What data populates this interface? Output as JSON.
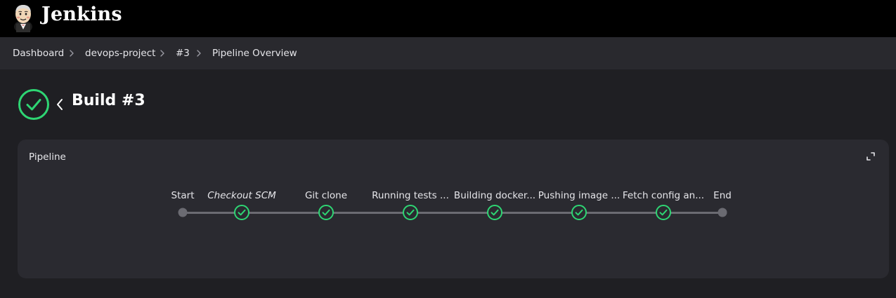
{
  "header": {
    "brand": "Jenkins",
    "logo_icon": "jenkins-butler-logo",
    "background": "#000000"
  },
  "breadcrumb": {
    "items": [
      {
        "label": "Dashboard"
      },
      {
        "label": "devops-project"
      },
      {
        "label": "#3"
      },
      {
        "label": "Pipeline Overview"
      }
    ]
  },
  "build": {
    "title": "Build #3",
    "status": "success",
    "status_icon": "check-circle-icon",
    "status_color": "#2ed573",
    "back_icon": "chevron-left-icon"
  },
  "pipeline": {
    "title": "Pipeline",
    "expand_icon": "expand-icon",
    "stages": [
      {
        "label": "Start",
        "kind": "terminal",
        "italic": false
      },
      {
        "label": "Checkout SCM",
        "kind": "success",
        "italic": true
      },
      {
        "label": "Git clone",
        "kind": "success",
        "italic": false
      },
      {
        "label": "Running tests ...",
        "kind": "success",
        "italic": false
      },
      {
        "label": "Building docker...",
        "kind": "success",
        "italic": false
      },
      {
        "label": "Pushing image ...",
        "kind": "success",
        "italic": false
      },
      {
        "label": "Fetch config an...",
        "kind": "success",
        "italic": false
      },
      {
        "label": "End",
        "kind": "terminal",
        "italic": false
      }
    ]
  }
}
